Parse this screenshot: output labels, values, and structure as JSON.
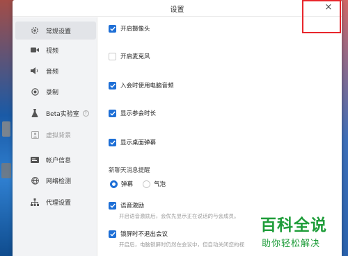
{
  "window": {
    "title": "设置",
    "close_glyph": "×"
  },
  "sidebar": {
    "items": [
      {
        "label": "常规设置",
        "icon": "gear-icon"
      },
      {
        "label": "视频",
        "icon": "video-camera-icon"
      },
      {
        "label": "音频",
        "icon": "speaker-icon"
      },
      {
        "label": "录制",
        "icon": "record-icon"
      },
      {
        "label": "Beta实验室",
        "icon": "flask-icon",
        "help": "?"
      },
      {
        "label": "虚拟背景",
        "icon": "person-background-icon"
      },
      {
        "label": "帐户信息",
        "icon": "id-card-icon"
      },
      {
        "label": "网络检测",
        "icon": "globe-icon"
      },
      {
        "label": "代理设置",
        "icon": "network-tree-icon"
      }
    ]
  },
  "options": {
    "camera": {
      "label": "开启摄像头",
      "checked": true
    },
    "mic": {
      "label": "开启麦克风",
      "checked": false
    },
    "computer_audio": {
      "label": "入会时使用电脑音频",
      "checked": true
    },
    "show_duration": {
      "label": "显示参会时长",
      "checked": true
    },
    "desktop_danmaku": {
      "label": "显示桌面弹幕",
      "checked": true
    },
    "chat_reminder": {
      "title": "新聊天消息提醒",
      "options": [
        "弹幕",
        "气泡"
      ],
      "selected": "弹幕"
    },
    "voice_excite": {
      "label": "语音激励",
      "checked": true,
      "desc": "开启语音激励后，会优先显示正在说话的与会成员。"
    },
    "lock_screen": {
      "label": "锁屏时不退出会议",
      "checked": true,
      "desc": "开启后，电脑锁屏时仍然在会议中，但自动关闭您的视"
    }
  },
  "watermark": {
    "title": "百科全说",
    "subtitle": "助你轻松解决"
  },
  "colors": {
    "accent": "#1e6fd6",
    "highlight_box": "#e8262c",
    "watermark": "#1f9d3a"
  }
}
